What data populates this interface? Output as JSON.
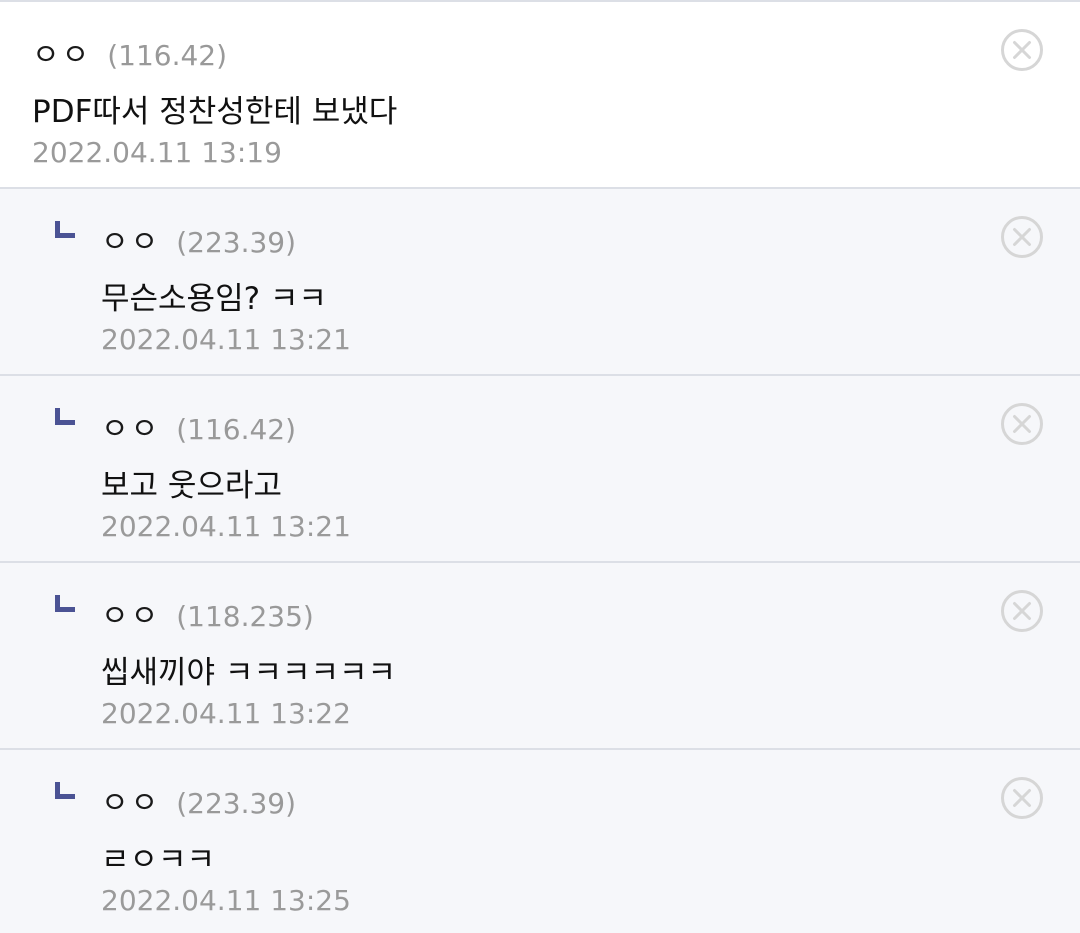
{
  "comments": [
    {
      "type": "top-level",
      "nickname": "ㅇㅇ",
      "ip": "(116.42)",
      "text": "PDF따서 정찬성한테 보냈다",
      "timestamp": "2022.04.11 13:19"
    },
    {
      "type": "reply",
      "nickname": "ㅇㅇ",
      "ip": "(223.39)",
      "text": "무슨소용임? ㅋㅋ",
      "timestamp": "2022.04.11 13:21"
    },
    {
      "type": "reply",
      "nickname": "ㅇㅇ",
      "ip": "(116.42)",
      "text": "보고 웃으라고",
      "timestamp": "2022.04.11 13:21"
    },
    {
      "type": "reply",
      "nickname": "ㅇㅇ",
      "ip": "(118.235)",
      "text": "씹새끼야 ㅋㅋㅋㅋㅋㅋ",
      "timestamp": "2022.04.11 13:22"
    },
    {
      "type": "reply",
      "nickname": "ㅇㅇ",
      "ip": "(223.39)",
      "text": "ㄹㅇㅋㅋ",
      "timestamp": "2022.04.11 13:25"
    }
  ],
  "icons": {
    "delete": "close-circle-icon",
    "reply_marker": "reply-corner-icon"
  },
  "colors": {
    "reply_background": "#f6f7fa",
    "reply_marker": "#4b5394",
    "divider": "#dcdfe6",
    "muted_text": "#9a9a9a"
  }
}
